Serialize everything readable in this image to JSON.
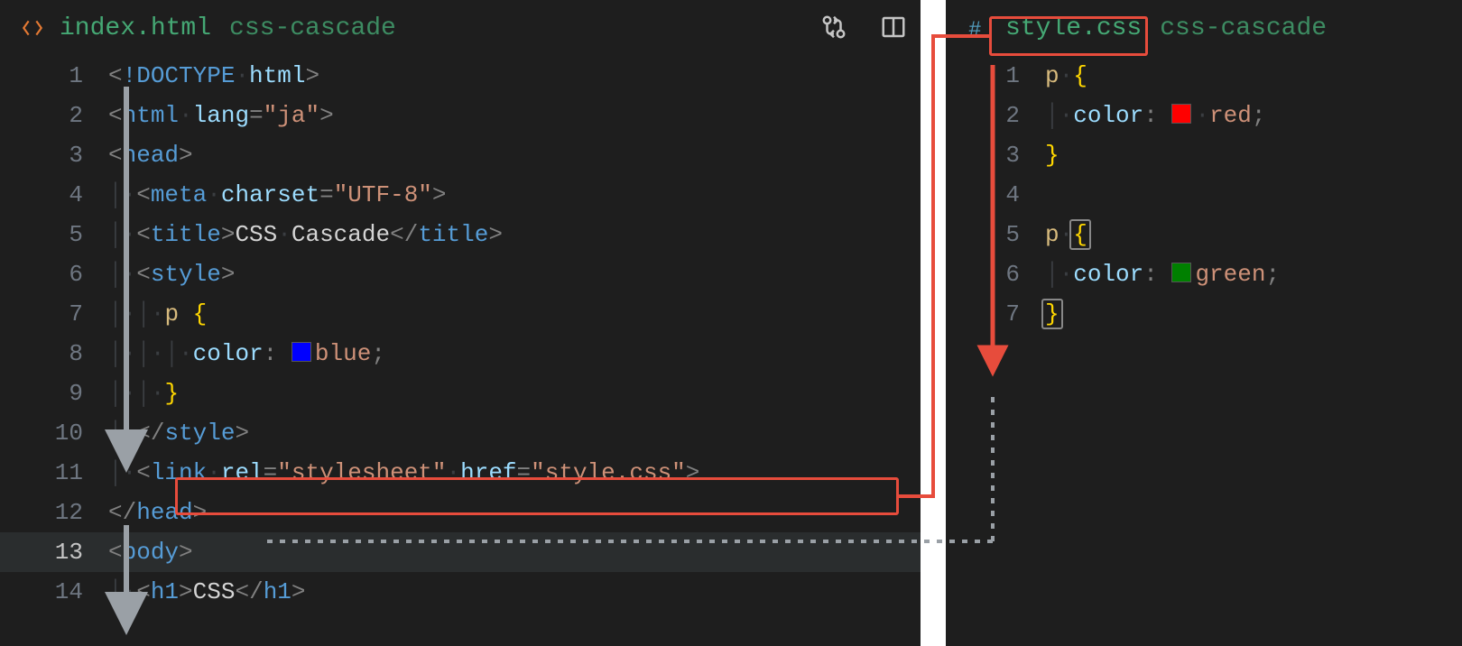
{
  "left": {
    "tab": {
      "filename": "index.html",
      "folder": "css-cascade"
    },
    "icons": {
      "git": "git-compare-icon",
      "split": "split-editor-icon",
      "html": "html-file-icon"
    },
    "lines": [
      {
        "n": 1,
        "tokens": [
          {
            "t": "<",
            "c": "punc"
          },
          {
            "t": "!DOCTYPE",
            "c": "tag"
          },
          {
            "t": "·",
            "c": "ws"
          },
          {
            "t": "html",
            "c": "attr"
          },
          {
            "t": ">",
            "c": "punc"
          }
        ]
      },
      {
        "n": 2,
        "tokens": [
          {
            "t": "<",
            "c": "punc"
          },
          {
            "t": "html",
            "c": "tag"
          },
          {
            "t": "·",
            "c": "ws"
          },
          {
            "t": "lang",
            "c": "attr"
          },
          {
            "t": "=",
            "c": "punc"
          },
          {
            "t": "\"ja\"",
            "c": "str"
          },
          {
            "t": ">",
            "c": "punc"
          }
        ]
      },
      {
        "n": 3,
        "tokens": [
          {
            "t": "<",
            "c": "punc"
          },
          {
            "t": "head",
            "c": "tag"
          },
          {
            "t": ">",
            "c": "punc"
          }
        ]
      },
      {
        "n": 4,
        "indent": 1,
        "tokens": [
          {
            "t": "<",
            "c": "punc"
          },
          {
            "t": "meta",
            "c": "tag"
          },
          {
            "t": "·",
            "c": "ws"
          },
          {
            "t": "charset",
            "c": "attr"
          },
          {
            "t": "=",
            "c": "punc"
          },
          {
            "t": "\"UTF-8\"",
            "c": "str"
          },
          {
            "t": ">",
            "c": "punc"
          }
        ]
      },
      {
        "n": 5,
        "indent": 1,
        "tokens": [
          {
            "t": "<",
            "c": "punc"
          },
          {
            "t": "title",
            "c": "tag"
          },
          {
            "t": ">",
            "c": "punc"
          },
          {
            "t": "CSS",
            "c": "text"
          },
          {
            "t": "·",
            "c": "ws"
          },
          {
            "t": "Cascade",
            "c": "text"
          },
          {
            "t": "</",
            "c": "punc"
          },
          {
            "t": "title",
            "c": "tag"
          },
          {
            "t": ">",
            "c": "punc"
          }
        ]
      },
      {
        "n": 6,
        "indent": 1,
        "tokens": [
          {
            "t": "<",
            "c": "punc"
          },
          {
            "t": "style",
            "c": "tag"
          },
          {
            "t": ">",
            "c": "punc"
          }
        ]
      },
      {
        "n": 7,
        "indent": 2,
        "tokens": [
          {
            "t": "p",
            "c": "sel"
          },
          {
            "t": " ",
            "c": "text"
          },
          {
            "t": "{",
            "c": "brace"
          }
        ]
      },
      {
        "n": 8,
        "indent": 3,
        "tokens": [
          {
            "t": "color",
            "c": "prop"
          },
          {
            "t": ":",
            "c": "punc"
          },
          {
            "t": " ",
            "c": "text"
          },
          {
            "swatch": "sw-blue"
          },
          {
            "t": "blue",
            "c": "kw"
          },
          {
            "t": ";",
            "c": "punc"
          }
        ]
      },
      {
        "n": 9,
        "indent": 2,
        "tokens": [
          {
            "t": "}",
            "c": "brace"
          }
        ]
      },
      {
        "n": 10,
        "indent": 1,
        "tokens": [
          {
            "t": "</",
            "c": "punc"
          },
          {
            "t": "style",
            "c": "tag"
          },
          {
            "t": ">",
            "c": "punc"
          }
        ]
      },
      {
        "n": 11,
        "indent": 1,
        "tokens": [
          {
            "t": "<",
            "c": "punc"
          },
          {
            "t": "link",
            "c": "tag"
          },
          {
            "t": "·",
            "c": "ws"
          },
          {
            "t": "rel",
            "c": "attr"
          },
          {
            "t": "=",
            "c": "punc"
          },
          {
            "t": "\"stylesheet\"",
            "c": "str"
          },
          {
            "t": "·",
            "c": "ws"
          },
          {
            "t": "href",
            "c": "attr"
          },
          {
            "t": "=",
            "c": "punc"
          },
          {
            "t": "\"style.css\"",
            "c": "str"
          },
          {
            "t": ">",
            "c": "punc"
          }
        ]
      },
      {
        "n": 12,
        "tokens": [
          {
            "t": "</",
            "c": "punc"
          },
          {
            "t": "head",
            "c": "tag"
          },
          {
            "t": ">",
            "c": "punc"
          }
        ]
      },
      {
        "n": 13,
        "active": true,
        "tokens": [
          {
            "t": "<",
            "c": "punc"
          },
          {
            "t": "body",
            "c": "tag"
          },
          {
            "t": ">",
            "c": "punc"
          }
        ]
      },
      {
        "n": 14,
        "indent": 1,
        "tokens": [
          {
            "t": "<",
            "c": "punc"
          },
          {
            "t": "h1",
            "c": "tag"
          },
          {
            "t": ">",
            "c": "punc"
          },
          {
            "t": "CSS",
            "c": "text"
          },
          {
            "t": "</",
            "c": "punc"
          },
          {
            "t": "h1",
            "c": "tag"
          },
          {
            "t": ">",
            "c": "punc"
          }
        ]
      }
    ]
  },
  "right": {
    "tab": {
      "filename": "style.css",
      "folder": "css-cascade"
    },
    "icons": {
      "css": "css-file-icon"
    },
    "lines": [
      {
        "n": 1,
        "tokens": [
          {
            "t": "p",
            "c": "sel"
          },
          {
            "t": "·",
            "c": "ws"
          },
          {
            "t": "{",
            "c": "brace"
          }
        ]
      },
      {
        "n": 2,
        "indent": 1,
        "tokens": [
          {
            "t": "color",
            "c": "prop"
          },
          {
            "t": ":",
            "c": "punc"
          },
          {
            "t": " ",
            "c": "text"
          },
          {
            "swatch": "sw-red"
          },
          {
            "t": "·",
            "c": "ws"
          },
          {
            "t": "red",
            "c": "kw"
          },
          {
            "t": ";",
            "c": "punc"
          }
        ]
      },
      {
        "n": 3,
        "tokens": [
          {
            "t": "}",
            "c": "brace"
          }
        ]
      },
      {
        "n": 4,
        "tokens": []
      },
      {
        "n": 5,
        "tokens": [
          {
            "t": "p",
            "c": "sel"
          },
          {
            "t": "·",
            "c": "ws"
          },
          {
            "t": "{",
            "c": "brace",
            "bp": true
          }
        ]
      },
      {
        "n": 6,
        "indent": 1,
        "tokens": [
          {
            "t": "color",
            "c": "prop"
          },
          {
            "t": ":",
            "c": "punc"
          },
          {
            "t": " ",
            "c": "text"
          },
          {
            "swatch": "sw-green"
          },
          {
            "t": "green",
            "c": "kw"
          },
          {
            "t": ";",
            "c": "punc"
          }
        ]
      },
      {
        "n": 7,
        "tokens": [
          {
            "t": "}",
            "c": "brace",
            "bp": true
          }
        ]
      }
    ]
  },
  "annotations": {
    "highlight_link_line": 11,
    "highlight_css_tab": true,
    "colors": {
      "highlight": "#e74c3c",
      "arrow_gray": "#9aa0a6"
    }
  }
}
